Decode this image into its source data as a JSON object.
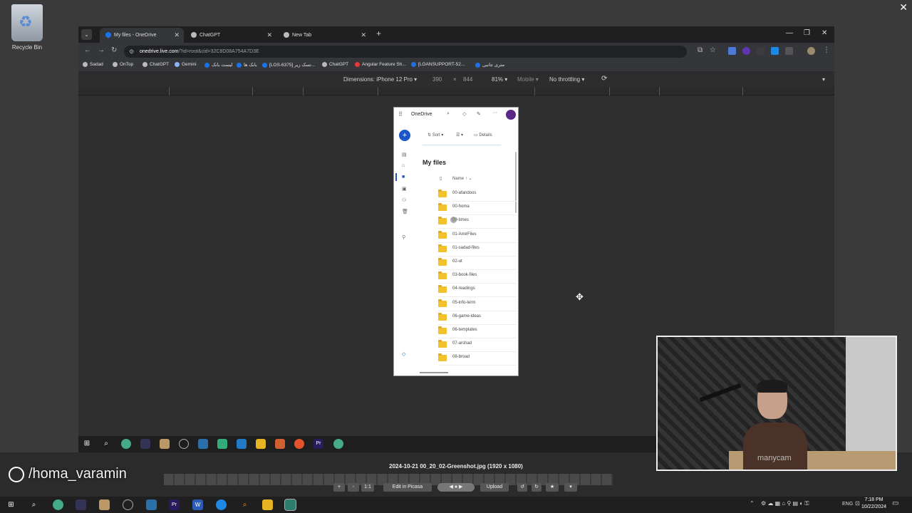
{
  "desktop": {
    "recycle_bin_label": "Recycle Bin",
    "close_glyph": "✕"
  },
  "browser": {
    "tabs": [
      {
        "label": "My files - OneDrive",
        "icon_color": "#1a73e8",
        "active": true
      },
      {
        "label": "ChatGPT",
        "icon_color": "#bbbbbb",
        "active": false
      },
      {
        "label": "New Tab",
        "icon_color": "#bbbbbb",
        "active": false
      }
    ],
    "url_host": "onedrive.live.com",
    "url_path": "/?id=root&cid=32C8D08A754A7D3E",
    "bookmarks": [
      {
        "label": "Sadad",
        "color": "#bbbbbb"
      },
      {
        "label": "OnTop",
        "color": "#bbbbbb"
      },
      {
        "label": "ChatGPT",
        "color": "#bbbbbb"
      },
      {
        "label": "Gemini",
        "color": "#8ab4f8"
      },
      {
        "label": "لیست بانک",
        "color": "#1a73e8"
      },
      {
        "label": "بانک ها",
        "color": "#1a73e8"
      },
      {
        "label": "[LOS-6375] تسک زیر...",
        "color": "#1a73e8"
      },
      {
        "label": "ChatGPT",
        "color": "#bbbbbb"
      },
      {
        "label": "Angular Feature Sh...",
        "color": "#e53935"
      },
      {
        "label": "[LOANSUPPORT-52...",
        "color": "#1a73e8"
      },
      {
        "label": "متری جانبی",
        "color": "#1a73e8"
      }
    ],
    "device_toolbar": {
      "dimensions_label": "Dimensions: iPhone 12 Pro",
      "width": "390",
      "times": "×",
      "height": "844",
      "zoom": "81%",
      "mode": "Mobile",
      "throttling": "No throttling"
    }
  },
  "onedrive": {
    "brand": "OneDrive",
    "sort_label": "Sort",
    "details_label": "Details",
    "page_title": "My files",
    "name_header": "Name ↑",
    "folders": [
      "00-afandoos",
      "00-homa",
      "00-times",
      "01-AmirFiles",
      "01-sadad-files",
      "02-ut",
      "03-book-files",
      "04-readings",
      "05-info-term",
      "06-game-ideas",
      "06-templates",
      "07-arshad",
      "08-broad"
    ]
  },
  "viewer": {
    "filename": "2024-10-21 00_20_02-Greenshot.jpg (1920 x 1080)",
    "buttons": [
      "+",
      "-",
      "1:1",
      "Edit in Picasa",
      "Upload"
    ],
    "watermark": "/homa_varamin"
  },
  "webcam": {
    "brand": "manycam"
  },
  "taskbar": {
    "time": "7:18 PM",
    "date": "10/22/2024",
    "lang": "ENG"
  }
}
